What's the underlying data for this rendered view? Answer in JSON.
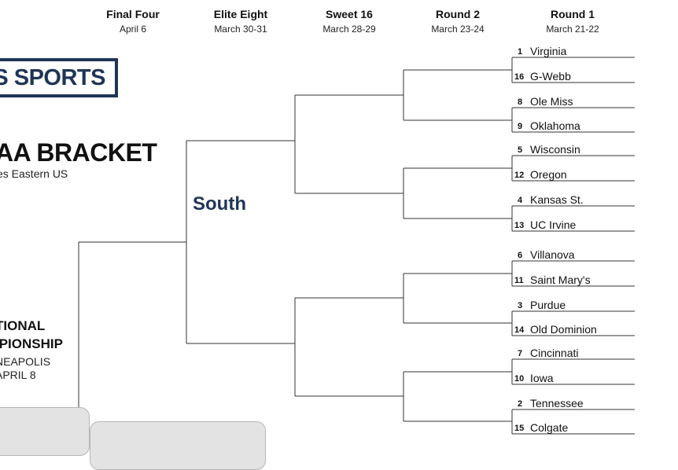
{
  "rounds": [
    {
      "name": "Final Four",
      "date": "April 6"
    },
    {
      "name": "Elite Eight",
      "date": "March 30-31"
    },
    {
      "name": "Sweet 16",
      "date": "March 28-29"
    },
    {
      "name": "Round 2",
      "date": "March 23-24"
    },
    {
      "name": "Round 1",
      "date": "March 21-22"
    }
  ],
  "logo": {
    "text": "S SPORTS"
  },
  "title": {
    "main": "AA BRACKET",
    "sub": "es Eastern US"
  },
  "region": {
    "name": "South"
  },
  "championship": {
    "line1": "TIONAL",
    "line2": "IPIONSHIP",
    "loc1": "NEAPOLIS",
    "loc2": "APRIL 8"
  },
  "teams": [
    {
      "seed": "1",
      "name": "Virginia"
    },
    {
      "seed": "16",
      "name": "G-Webb"
    },
    {
      "seed": "8",
      "name": "Ole Miss"
    },
    {
      "seed": "9",
      "name": "Oklahoma"
    },
    {
      "seed": "5",
      "name": "Wisconsin"
    },
    {
      "seed": "12",
      "name": "Oregon"
    },
    {
      "seed": "4",
      "name": "Kansas St."
    },
    {
      "seed": "13",
      "name": "UC Irvine"
    },
    {
      "seed": "6",
      "name": "Villanova"
    },
    {
      "seed": "11",
      "name": "Saint Mary's"
    },
    {
      "seed": "3",
      "name": "Purdue"
    },
    {
      "seed": "14",
      "name": "Old Dominion"
    },
    {
      "seed": "7",
      "name": "Cincinnati"
    },
    {
      "seed": "10",
      "name": "Iowa"
    },
    {
      "seed": "2",
      "name": "Tennessee"
    },
    {
      "seed": "15",
      "name": "Colgate"
    }
  ]
}
